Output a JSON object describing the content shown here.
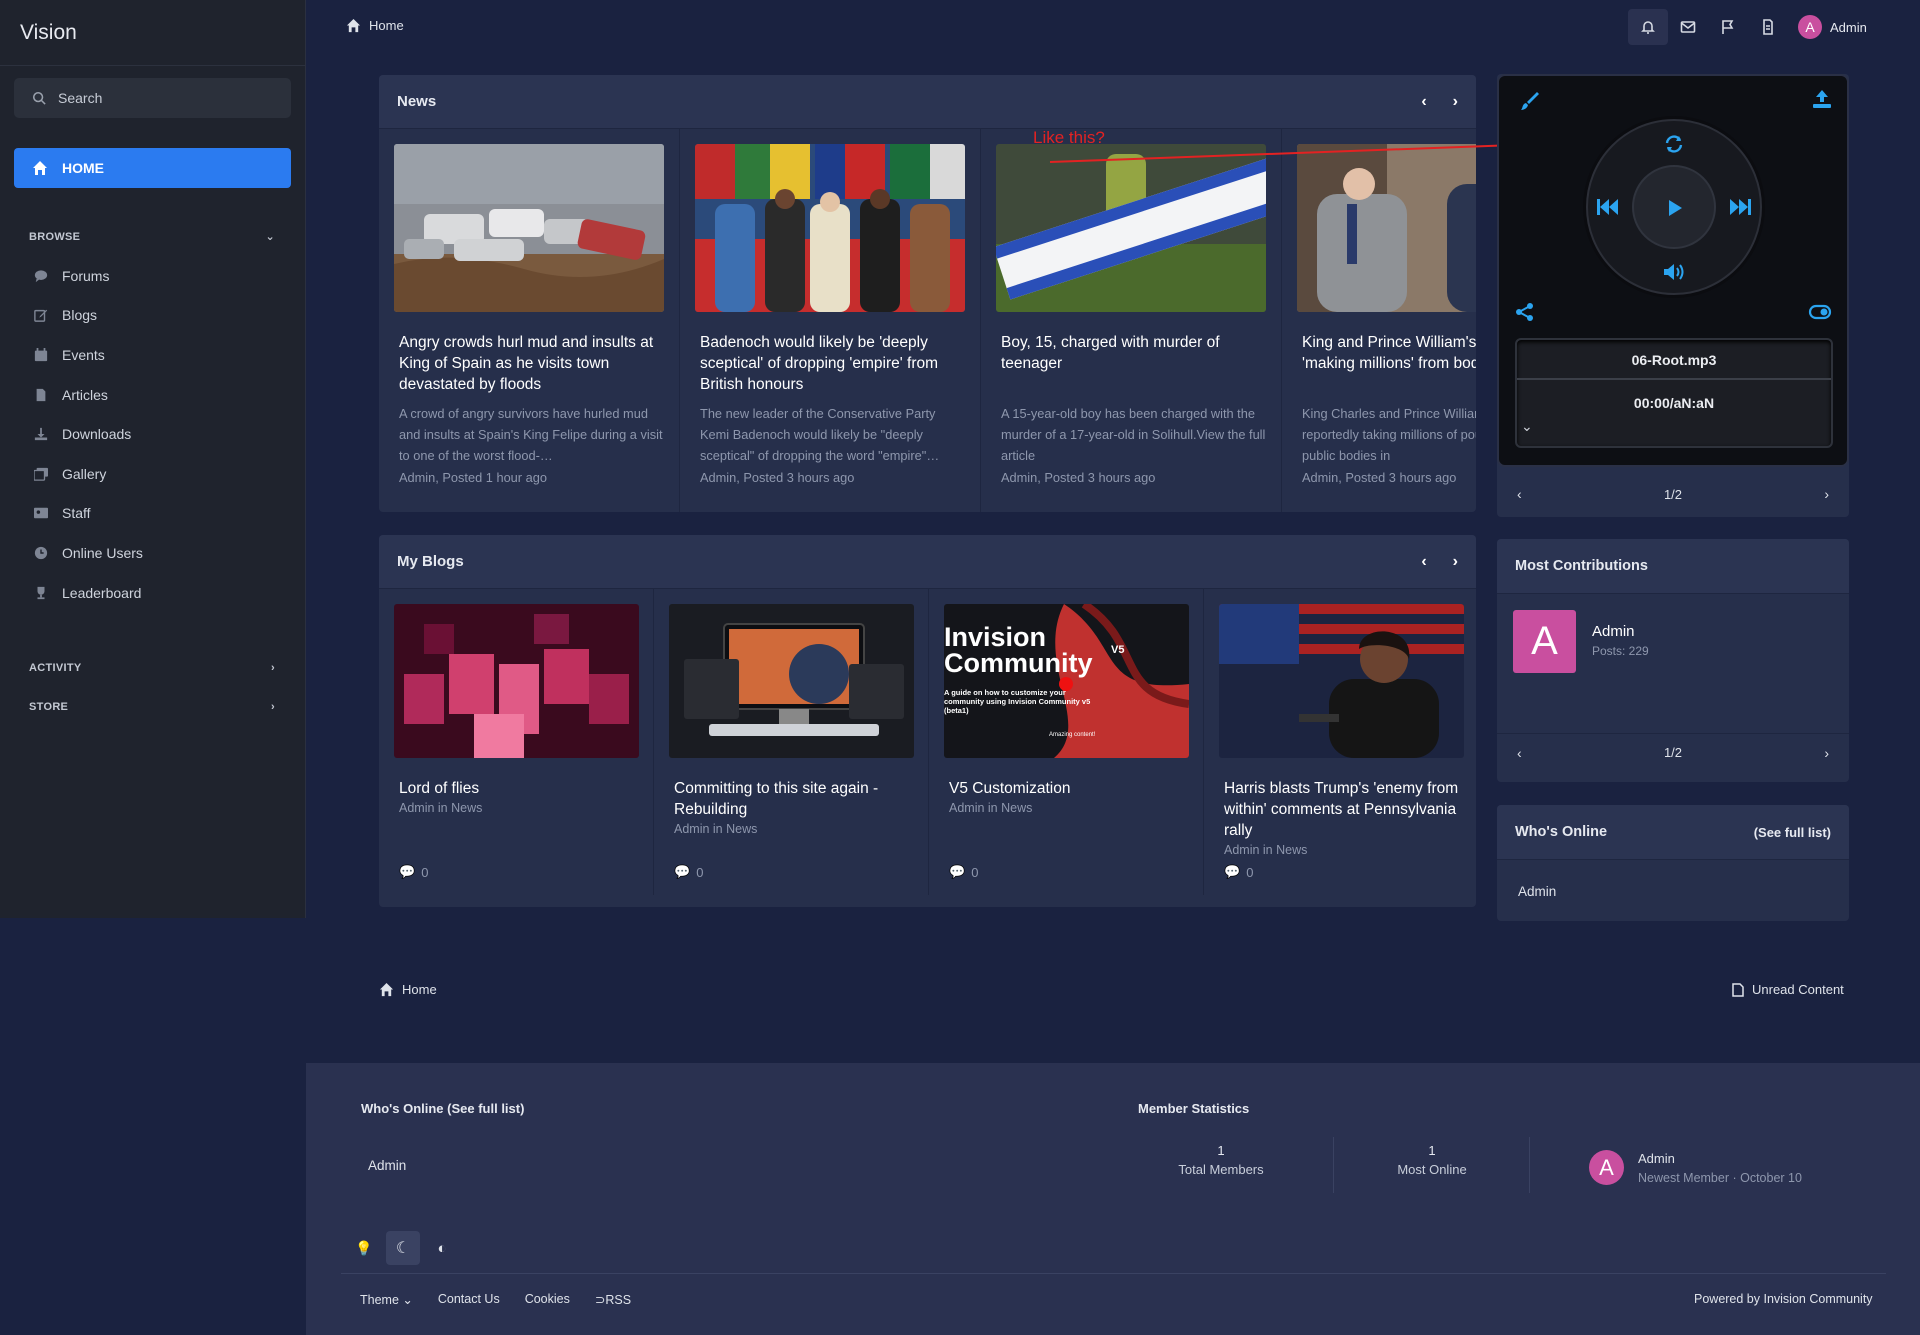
{
  "sidebar": {
    "brand": "Vision",
    "search_placeholder": "Search",
    "home_label": "HOME",
    "browse_label": "BROWSE",
    "items": [
      "Forums",
      "Blogs",
      "Events",
      "Articles",
      "Downloads",
      "Gallery",
      "Staff",
      "Online Users",
      "Leaderboard"
    ],
    "activity_label": "ACTIVITY",
    "store_label": "STORE"
  },
  "topbar": {
    "breadcrumb": "Home",
    "user_name": "Admin",
    "avatar_letter": "A"
  },
  "news": {
    "title": "News",
    "cards": [
      {
        "title": "Angry crowds hurl mud and insults at King of Spain as he visits town devastated by floods",
        "desc": "A crowd of angry survivors have hurled mud and insults at Spain's King Felipe during a visit to one of the worst flood-…",
        "meta": "Admin, Posted 1 hour ago"
      },
      {
        "title": "Badenoch would likely be 'deeply sceptical' of dropping 'empire' from British honours",
        "desc": "The new leader of the Conservative Party Kemi Badenoch would likely be \"deeply sceptical\" of dropping the word \"empire\"…",
        "meta": "Admin, Posted 3 hours ago"
      },
      {
        "title": "Boy, 15, charged with murder of teenager",
        "desc": "A 15-year-old boy has been charged with the murder of a 17-year-old in Solihull.View the full article",
        "meta": "Admin, Posted 3 hours ago"
      },
      {
        "title": "King and Prince William's estates 'making millions' from bodies'",
        "desc": "King Charles and Prince William's estates are reportedly taking millions of pounds from public bodies in",
        "meta": "Admin, Posted 3 hours ago"
      }
    ]
  },
  "annotation": "Like this?",
  "player": {
    "track": "06-Root.mp3",
    "time": "00:00/aN:aN",
    "pager": "1/2"
  },
  "blogs": {
    "title": "My Blogs",
    "cards": [
      {
        "title": "Lord of flies",
        "meta": "Admin in News",
        "comments": "0"
      },
      {
        "title": "Committing to this site again - Rebuilding",
        "meta": "Admin in News",
        "comments": "0"
      },
      {
        "title": "V5 Customization",
        "meta": "Admin in News",
        "comments": "0",
        "thumb_text": "Invision Community",
        "thumb_sub": "V5",
        "thumb_caption": "A guide on how to customize your community using Invision Community v5 (beta1)",
        "thumb_small": "Amazing content!"
      },
      {
        "title": "Harris blasts Trump's 'enemy from within' comments at Pennsylvania rally",
        "meta": "Admin in News",
        "comments": "0"
      }
    ]
  },
  "contrib": {
    "title": "Most Contributions",
    "name": "Admin",
    "posts": "Posts: 229",
    "avatar_letter": "A",
    "pager": "1/2"
  },
  "whos_online": {
    "title": "Who's Online",
    "link": "(See full list)",
    "user": "Admin"
  },
  "bottom_crumb": {
    "home": "Home",
    "unread": "Unread Content"
  },
  "footer": {
    "online_title": "Who's Online (See full list)",
    "online_user": "Admin",
    "stats_title": "Member Statistics",
    "total_members": "1",
    "total_members_label": "Total Members",
    "most_online": "1",
    "most_online_label": "Most Online",
    "newest_name": "Admin",
    "newest_label": "Newest Member · October 10",
    "avatar_letter": "A",
    "links": [
      "Theme",
      "Contact Us",
      "Cookies",
      "RSS"
    ],
    "powered": "Powered by Invision Community"
  }
}
